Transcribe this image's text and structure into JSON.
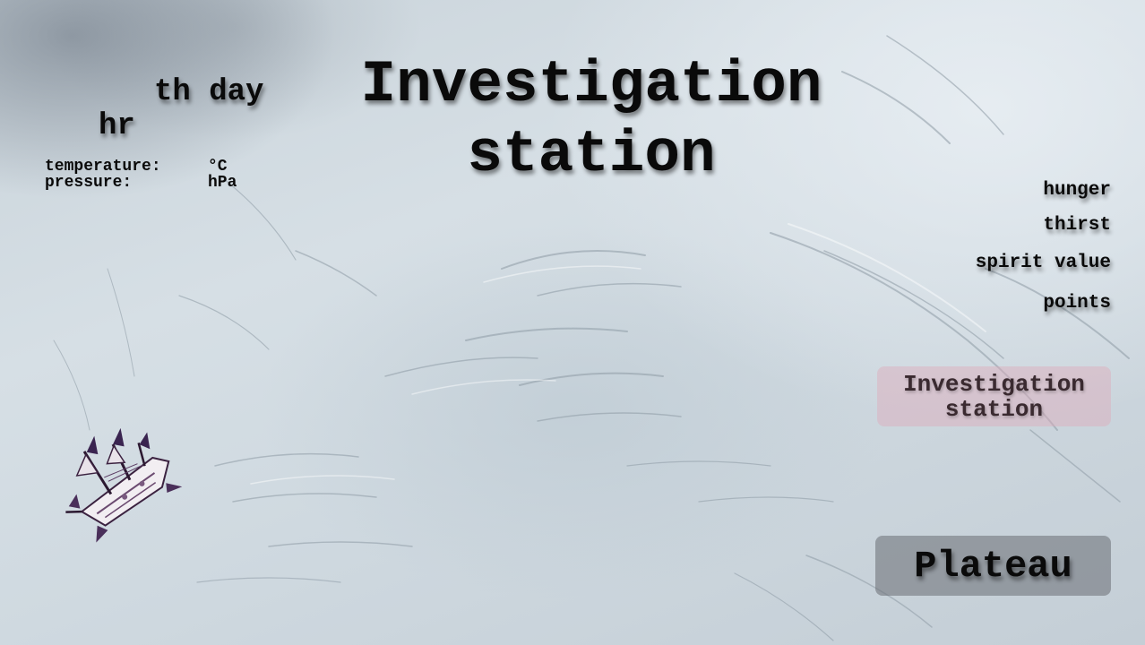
{
  "time": {
    "day_suffix": "th day",
    "hour_suffix": "hr"
  },
  "weather": {
    "temperature_label": "temperature:",
    "temperature_unit": "°C",
    "pressure_label": "pressure:",
    "pressure_unit": "hPa"
  },
  "location": {
    "title_line1": "Investigation",
    "title_line2": "station"
  },
  "stats": {
    "hunger_label": "hunger",
    "thirst_label": "thirst",
    "spirit_label": "spirit value",
    "points_label": "points"
  },
  "actions": {
    "current_location_line1": "Investigation",
    "current_location_line2": "station",
    "destination_label": "Plateau"
  },
  "colors": {
    "snow_background": "#d2dbe1",
    "current_location_button": "#deaaba",
    "destination_button": "#6e7278"
  },
  "icons": {
    "player_marker": "wrecked-ship-icon"
  }
}
